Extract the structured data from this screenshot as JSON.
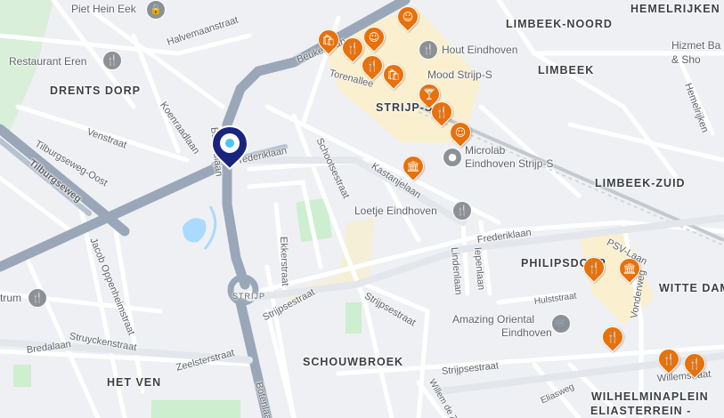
{
  "areas": {
    "limbeek_noord": "LIMBEEK-NOORD",
    "hemelrijken": "HEMELRIJKEN",
    "limbeek": "LIMBEEK",
    "drents_dorp": "DRENTS DORP",
    "strijp_s": "STRIJP-S",
    "limbeek_zuid": "LIMBEEK-ZUID",
    "philipsdorp": "PHILIPSDORP",
    "witte_dame": "WITTE DAM",
    "schouwbroek": "SCHOUWBROEK",
    "het_ven": "HET VEN",
    "wilhelminaplein": "WILHELMINAPLEIN",
    "eliasterrein": "ELIASTERREIN -",
    "strijp_small": "STRIJP"
  },
  "streets": {
    "halvemaanstraat": "Halvemaanstraat",
    "beukenlaan": "Beukenlaan",
    "torenallee": "Torenallee",
    "koenraadlaan": "Koenraadlaan",
    "venstraat": "Venstraat",
    "tilburgseweg_oost": "Tilburgseweg-Oost",
    "tilburgseweg": "Tilburgseweg",
    "beemdlaan": "Beemdlaan",
    "frederiklaan_left": "Frederiklaan",
    "schootsestraat": "Schootsestraat",
    "kastanjelaan": "Kastanjelaan",
    "frederiklaan": "Frederiklaan",
    "lindenlaan": "Lindenlaan",
    "iepenlaan": "Iepenlaan",
    "psv_laan": "PSV-Laan",
    "hemelrijken_st": "Hemelrijken",
    "jacob_oppenheim": "Jacob Oppenheimstraat",
    "ekkerstraat": "Ekkerstraat",
    "strijpsestraat_diag": "Strijpsestraat",
    "strijpsestraat_b": "Strijpsestraat",
    "strijpsestraat_c": "Strijpsestraat",
    "struyckenstraat": "Struyckenstraat",
    "bredalaan": "Bredalaan",
    "zeelsterstraat": "Zeelsterstraat",
    "botenlaan": "Botenlaan",
    "willem_de_zwijger": "Willem de Zw",
    "hulststraat": "Hulststraat",
    "vonderweg": "Vonderweg",
    "willemstraat": "Willemstraat",
    "elias": "Eliasweg"
  },
  "pois": {
    "piet_hein_eek": "Piet Hein Eek",
    "restaurant_eren": "Restaurant Eren",
    "hout_eindhoven": "Hout Eindhoven",
    "mood_strijp_s": "Mood Strijp-S",
    "hizmet_line1": "Hizmet Ba",
    "hizmet_line2": "& Sho",
    "microlab_line1": "Microlab",
    "microlab_line2": "Eindhoven Strijp-S",
    "loetje": "Loetje Eindhoven",
    "trum": "trum",
    "amazing_line1": "Amazing Oriental",
    "amazing_line2": "Eindhoven"
  },
  "pin_icons": {
    "restaurant": "🍴",
    "shopping": "🛍",
    "smiley": "☺",
    "bar": "🍸",
    "museum": "🏛",
    "cart": "🛒",
    "lock": "🔒"
  },
  "colors": {
    "orange_pin": "#e8710a",
    "selected_pin": "#1a237e",
    "highway": "#9aa7b8",
    "road": "#ffffff",
    "park": "#cdeecf",
    "water": "#aadaff",
    "district": "#fcefc6"
  }
}
